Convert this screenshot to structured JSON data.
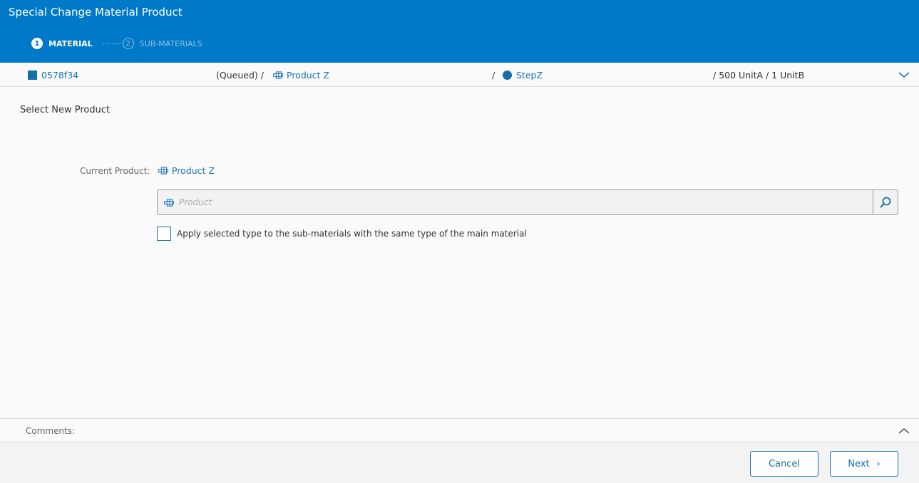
{
  "header": {
    "title": "Special Change Material Product",
    "steps": [
      {
        "num": "1",
        "label": "MATERIAL"
      },
      {
        "num": "2",
        "label": "SUB-MATERIALS"
      }
    ]
  },
  "context": {
    "material_id": "0578f34",
    "status": "(Queued)",
    "sep": "/",
    "product": "Product Z",
    "step": "StepZ",
    "qty_a": "500 UnitA",
    "qty_b": "1 UnitB"
  },
  "main": {
    "section_title": "Select New Product",
    "current_label": "Current Product:",
    "current_value": "Product Z",
    "product_placeholder": "Product",
    "checkbox_label": "Apply selected type to the sub-materials with the same type of the main material"
  },
  "comments": {
    "label": "Comments:"
  },
  "footer": {
    "cancel": "Cancel",
    "next": "Next"
  }
}
